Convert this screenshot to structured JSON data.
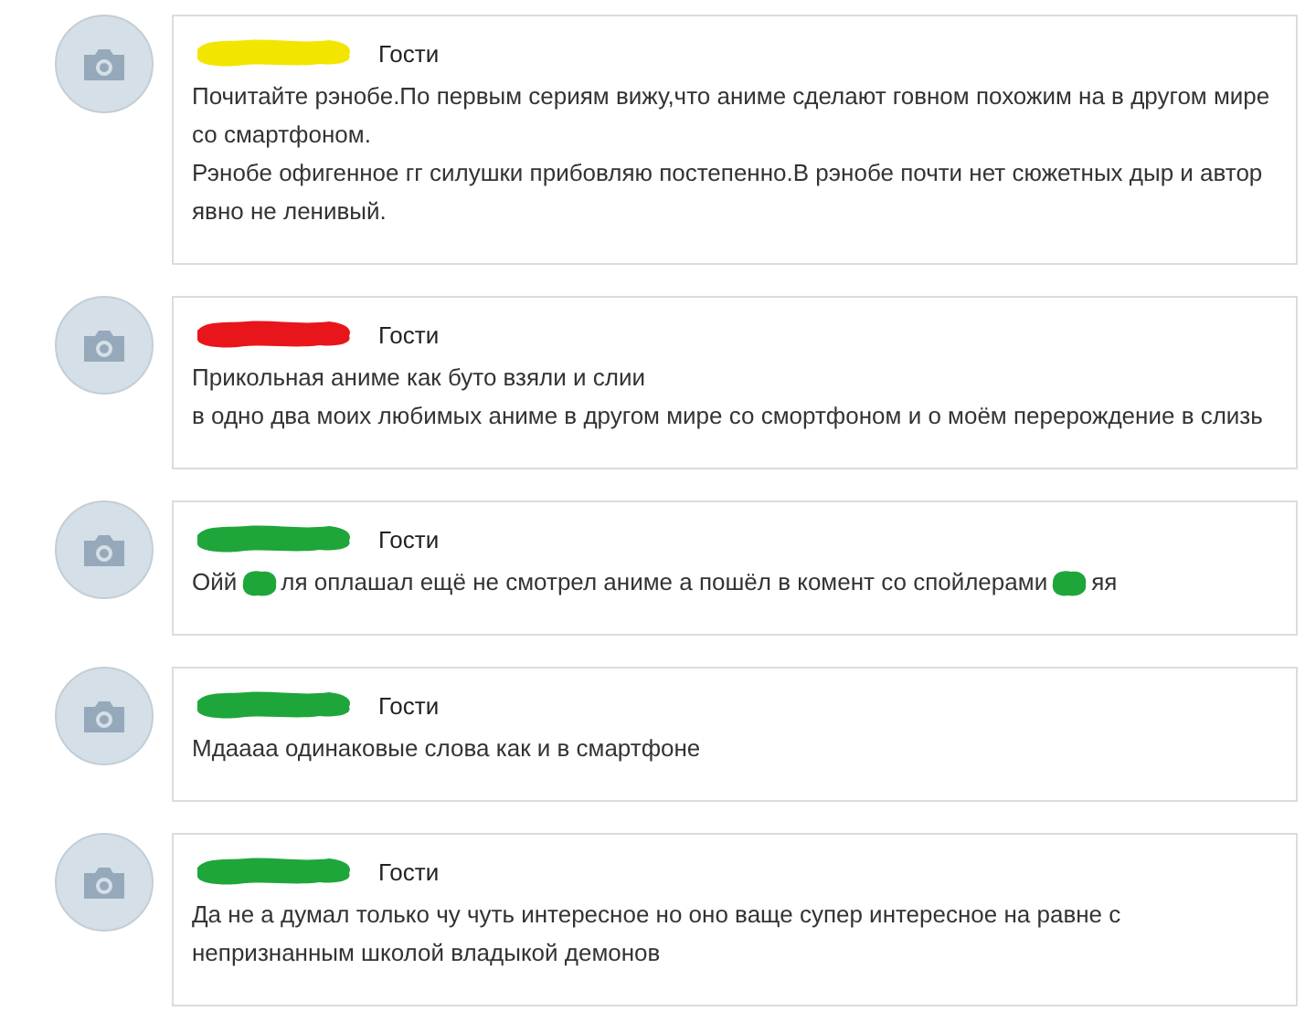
{
  "comments": [
    {
      "name_scribble": {
        "color": "#f2e600"
      },
      "role": "Гости",
      "paragraphs": [
        {
          "segments": [
            {
              "kind": "text",
              "text": "Почитайте рэнобе.По первым сериям вижу,что аниме сделают говном похожим на в другом мире со смартфоном."
            }
          ]
        },
        {
          "segments": [
            {
              "kind": "text",
              "text": "Рэнобе офигенное гг силушки прибовляю постепенно.В рэнобе почти нет сюжетных дыр и автор явно не ленивый."
            }
          ]
        }
      ]
    },
    {
      "name_scribble": {
        "color": "#e8161b"
      },
      "role": "Гости",
      "paragraphs": [
        {
          "segments": [
            {
              "kind": "text",
              "text": "Прикольная аниме как буто взяли и слии"
            }
          ]
        },
        {
          "segments": [
            {
              "kind": "text",
              "text": "в одно два моих любимых аниме в другом мире со смортфоном и о моём перерождение в слизь"
            }
          ]
        }
      ]
    },
    {
      "name_scribble": {
        "color": "#1fa63a"
      },
      "role": "Гости",
      "paragraphs": [
        {
          "segments": [
            {
              "kind": "text",
              "text": "Ойй"
            },
            {
              "kind": "scribble",
              "color": "#1fa63a"
            },
            {
              "kind": "text",
              "text": "ля оплашал ещё не смотрел аниме а пошёл в комент со спойлерами"
            },
            {
              "kind": "scribble",
              "color": "#1fa63a"
            },
            {
              "kind": "text",
              "text": "яя"
            }
          ]
        }
      ]
    },
    {
      "name_scribble": {
        "color": "#1fa63a"
      },
      "role": "Гости",
      "paragraphs": [
        {
          "segments": [
            {
              "kind": "text",
              "text": "Мдаааа одинаковые слова как и в смартфоне"
            }
          ]
        }
      ]
    },
    {
      "name_scribble": {
        "color": "#1fa63a"
      },
      "role": "Гости",
      "paragraphs": [
        {
          "segments": [
            {
              "kind": "text",
              "text": "Да не а думал только чу чуть интересное но оно ваще супер интересное на равне с непризнанным школой владыкой демонов"
            }
          ]
        }
      ]
    }
  ]
}
